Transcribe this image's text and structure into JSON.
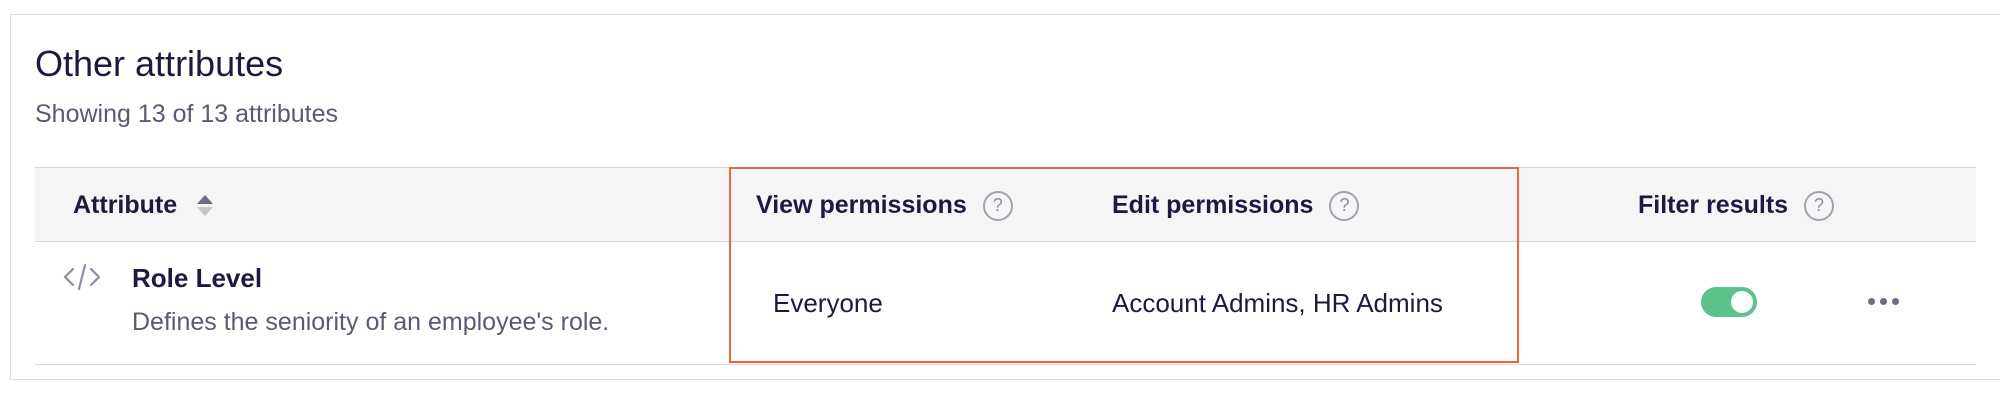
{
  "section": {
    "title": "Other attributes",
    "subtitle": "Showing 13 of 13 attributes"
  },
  "table": {
    "columns": {
      "attribute": "Attribute",
      "view_permissions": "View permissions",
      "edit_permissions": "Edit permissions",
      "filter_results": "Filter results"
    },
    "rows": [
      {
        "icon": "code-icon",
        "name": "Role Level",
        "description": "Defines the seniority of an employee's role.",
        "view_permissions": "Everyone",
        "edit_permissions": "Account Admins, HR Admins",
        "filter_results_enabled": true
      }
    ]
  },
  "colors": {
    "highlight_border": "#e3673f",
    "toggle_on": "#5cc28a",
    "text_primary": "#1d1a3f",
    "text_secondary": "#5c5a73"
  }
}
